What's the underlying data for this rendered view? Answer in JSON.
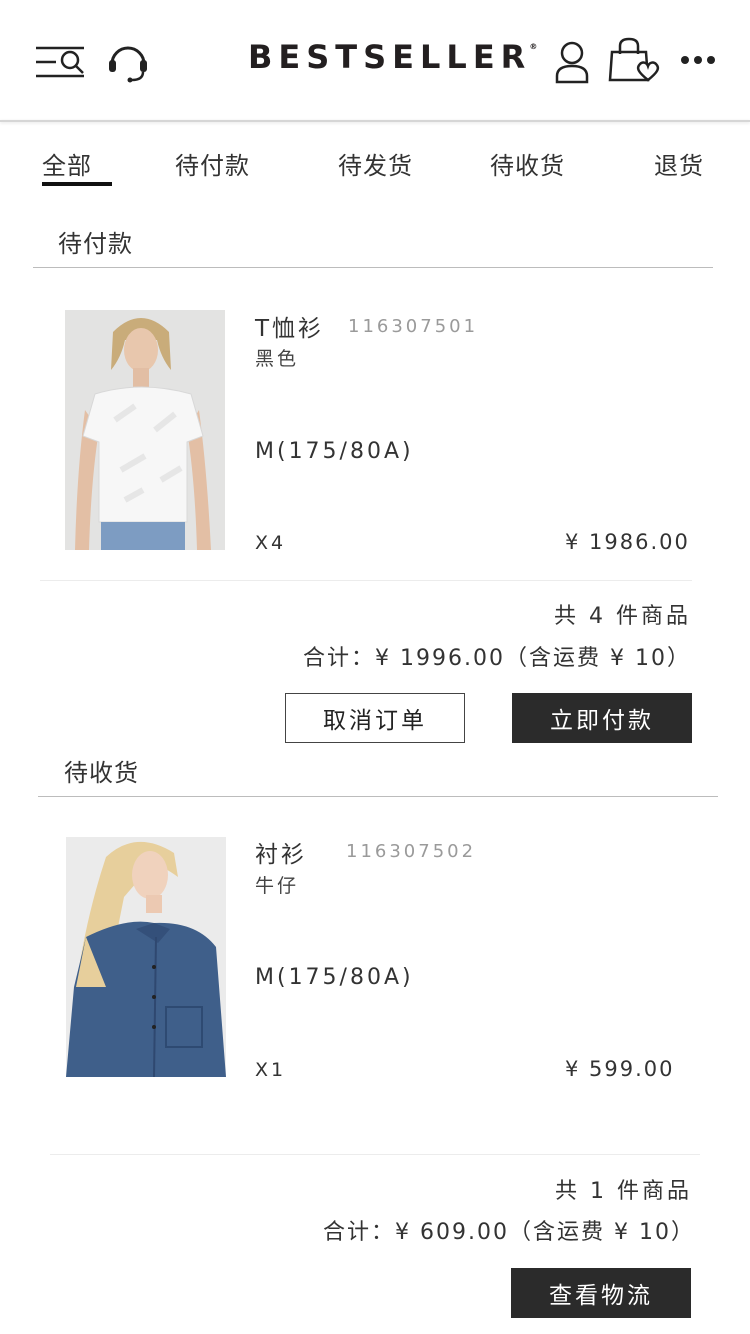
{
  "header": {
    "brand": "BESTSELLER",
    "brand_mark": "®",
    "icons": [
      "menu-search-icon",
      "headset-icon",
      "user-icon",
      "shopping-bag-heart-icon",
      "more-icon"
    ]
  },
  "tabs": [
    {
      "label": "全部",
      "active": true
    },
    {
      "label": "待付款",
      "active": false
    },
    {
      "label": "待发货",
      "active": false
    },
    {
      "label": "待收货",
      "active": false
    },
    {
      "label": "退货",
      "active": false
    }
  ],
  "orders": [
    {
      "status": "待付款",
      "item": {
        "name": "T恤衫",
        "code": "116307501",
        "color": "黑色",
        "size": "M(175/80A)",
        "qty": "X4",
        "price": "¥ 1986.00"
      },
      "count_text": "共 4 件商品",
      "total_text": "合计：¥ 1996.00（含运费 ¥ 10）",
      "buttons": [
        "取消订单",
        "立即付款"
      ]
    },
    {
      "status": "待收货",
      "item": {
        "name": "衬衫",
        "code": "116307502",
        "color": "牛仔",
        "size": "M(175/80A)",
        "qty": "X1",
        "price": "¥ 599.00"
      },
      "count_text": "共 1 件商品",
      "total_text": "合计：¥ 609.00（含运费 ¥ 10）",
      "buttons": [
        "查看物流"
      ]
    }
  ],
  "colors": {
    "accent_dark": "#2b2b2b",
    "text": "#333333",
    "muted": "#9a9a9a",
    "tshirt_bg": "#e4e4e4",
    "denim": "#3f5f8a"
  }
}
